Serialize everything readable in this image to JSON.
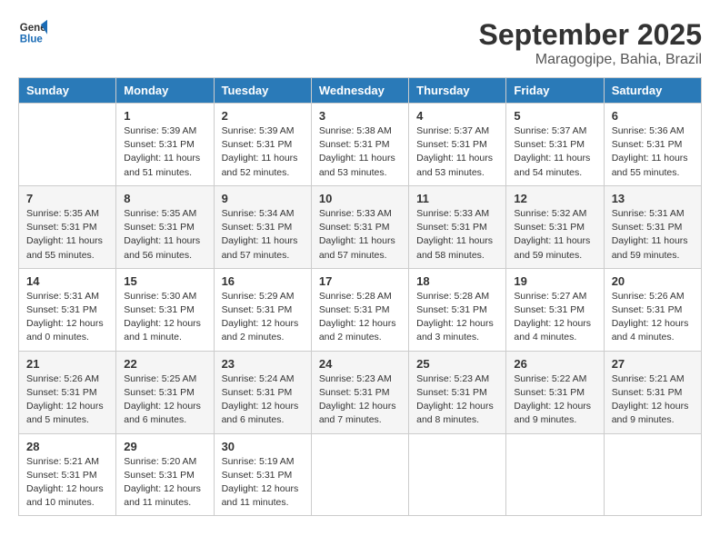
{
  "header": {
    "logo_line1": "General",
    "logo_line2": "Blue",
    "month": "September 2025",
    "location": "Maragogipe, Bahia, Brazil"
  },
  "days_of_week": [
    "Sunday",
    "Monday",
    "Tuesday",
    "Wednesday",
    "Thursday",
    "Friday",
    "Saturday"
  ],
  "weeks": [
    [
      {
        "num": "",
        "info": ""
      },
      {
        "num": "1",
        "info": "Sunrise: 5:39 AM\nSunset: 5:31 PM\nDaylight: 11 hours\nand 51 minutes."
      },
      {
        "num": "2",
        "info": "Sunrise: 5:39 AM\nSunset: 5:31 PM\nDaylight: 11 hours\nand 52 minutes."
      },
      {
        "num": "3",
        "info": "Sunrise: 5:38 AM\nSunset: 5:31 PM\nDaylight: 11 hours\nand 53 minutes."
      },
      {
        "num": "4",
        "info": "Sunrise: 5:37 AM\nSunset: 5:31 PM\nDaylight: 11 hours\nand 53 minutes."
      },
      {
        "num": "5",
        "info": "Sunrise: 5:37 AM\nSunset: 5:31 PM\nDaylight: 11 hours\nand 54 minutes."
      },
      {
        "num": "6",
        "info": "Sunrise: 5:36 AM\nSunset: 5:31 PM\nDaylight: 11 hours\nand 55 minutes."
      }
    ],
    [
      {
        "num": "7",
        "info": "Sunrise: 5:35 AM\nSunset: 5:31 PM\nDaylight: 11 hours\nand 55 minutes."
      },
      {
        "num": "8",
        "info": "Sunrise: 5:35 AM\nSunset: 5:31 PM\nDaylight: 11 hours\nand 56 minutes."
      },
      {
        "num": "9",
        "info": "Sunrise: 5:34 AM\nSunset: 5:31 PM\nDaylight: 11 hours\nand 57 minutes."
      },
      {
        "num": "10",
        "info": "Sunrise: 5:33 AM\nSunset: 5:31 PM\nDaylight: 11 hours\nand 57 minutes."
      },
      {
        "num": "11",
        "info": "Sunrise: 5:33 AM\nSunset: 5:31 PM\nDaylight: 11 hours\nand 58 minutes."
      },
      {
        "num": "12",
        "info": "Sunrise: 5:32 AM\nSunset: 5:31 PM\nDaylight: 11 hours\nand 59 minutes."
      },
      {
        "num": "13",
        "info": "Sunrise: 5:31 AM\nSunset: 5:31 PM\nDaylight: 11 hours\nand 59 minutes."
      }
    ],
    [
      {
        "num": "14",
        "info": "Sunrise: 5:31 AM\nSunset: 5:31 PM\nDaylight: 12 hours\nand 0 minutes."
      },
      {
        "num": "15",
        "info": "Sunrise: 5:30 AM\nSunset: 5:31 PM\nDaylight: 12 hours\nand 1 minute."
      },
      {
        "num": "16",
        "info": "Sunrise: 5:29 AM\nSunset: 5:31 PM\nDaylight: 12 hours\nand 2 minutes."
      },
      {
        "num": "17",
        "info": "Sunrise: 5:28 AM\nSunset: 5:31 PM\nDaylight: 12 hours\nand 2 minutes."
      },
      {
        "num": "18",
        "info": "Sunrise: 5:28 AM\nSunset: 5:31 PM\nDaylight: 12 hours\nand 3 minutes."
      },
      {
        "num": "19",
        "info": "Sunrise: 5:27 AM\nSunset: 5:31 PM\nDaylight: 12 hours\nand 4 minutes."
      },
      {
        "num": "20",
        "info": "Sunrise: 5:26 AM\nSunset: 5:31 PM\nDaylight: 12 hours\nand 4 minutes."
      }
    ],
    [
      {
        "num": "21",
        "info": "Sunrise: 5:26 AM\nSunset: 5:31 PM\nDaylight: 12 hours\nand 5 minutes."
      },
      {
        "num": "22",
        "info": "Sunrise: 5:25 AM\nSunset: 5:31 PM\nDaylight: 12 hours\nand 6 minutes."
      },
      {
        "num": "23",
        "info": "Sunrise: 5:24 AM\nSunset: 5:31 PM\nDaylight: 12 hours\nand 6 minutes."
      },
      {
        "num": "24",
        "info": "Sunrise: 5:23 AM\nSunset: 5:31 PM\nDaylight: 12 hours\nand 7 minutes."
      },
      {
        "num": "25",
        "info": "Sunrise: 5:23 AM\nSunset: 5:31 PM\nDaylight: 12 hours\nand 8 minutes."
      },
      {
        "num": "26",
        "info": "Sunrise: 5:22 AM\nSunset: 5:31 PM\nDaylight: 12 hours\nand 9 minutes."
      },
      {
        "num": "27",
        "info": "Sunrise: 5:21 AM\nSunset: 5:31 PM\nDaylight: 12 hours\nand 9 minutes."
      }
    ],
    [
      {
        "num": "28",
        "info": "Sunrise: 5:21 AM\nSunset: 5:31 PM\nDaylight: 12 hours\nand 10 minutes."
      },
      {
        "num": "29",
        "info": "Sunrise: 5:20 AM\nSunset: 5:31 PM\nDaylight: 12 hours\nand 11 minutes."
      },
      {
        "num": "30",
        "info": "Sunrise: 5:19 AM\nSunset: 5:31 PM\nDaylight: 12 hours\nand 11 minutes."
      },
      {
        "num": "",
        "info": ""
      },
      {
        "num": "",
        "info": ""
      },
      {
        "num": "",
        "info": ""
      },
      {
        "num": "",
        "info": ""
      }
    ]
  ]
}
